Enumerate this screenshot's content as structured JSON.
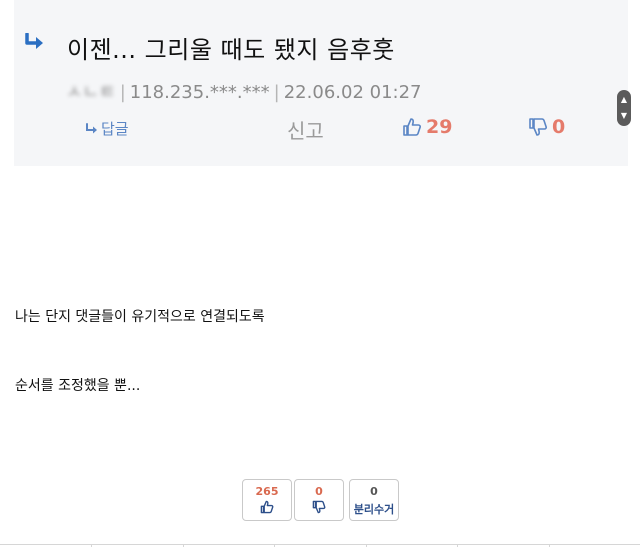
{
  "comment": {
    "text": "이젠... 그리울 때도 됐지 음후훗",
    "nickname": "ㅅㄴㅌ",
    "ip": "118.235.***.***",
    "date": "22.06.02 01:27",
    "separator": "|",
    "reply_label": "답글",
    "report_label": "신고",
    "like_count": "29",
    "dislike_count": "0",
    "icons": {
      "reply_arrow": "reply-arrow-icon",
      "like": "thumbs-up-icon",
      "dislike": "thumbs-down-icon"
    }
  },
  "post": {
    "line1": "나는 단지 댓글들이 유기적으로 연결되도록",
    "line2": "순서를 조정했을 뿐..."
  },
  "votes": {
    "recommend_count": "265",
    "not_recommend_count": "0",
    "separate_count": "0",
    "separate_label": "분리수거"
  },
  "colors": {
    "comment_bg": "#f5f6f8",
    "accent_blue": "#2b6fc2",
    "count_red": "#e57b6b",
    "meta_gray": "#8a8a8a"
  }
}
